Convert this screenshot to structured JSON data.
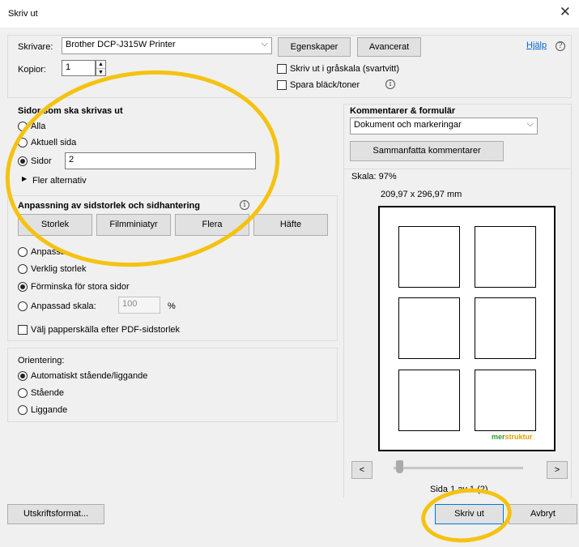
{
  "window": {
    "title": "Skriv ut",
    "close_glyph": "✕"
  },
  "printer": {
    "label": "Skrivare:",
    "value": "Brother DCP-J315W Printer",
    "properties_label": "Egenskaper",
    "advanced_label": "Avancerat",
    "help_label": "Hjälp"
  },
  "copies": {
    "label": "Kopior:",
    "value": "1"
  },
  "options": {
    "grayscale_label": "Skriv ut i gråskala (svartvitt)",
    "grayscale_checked": false,
    "save_ink_label": "Spara bläck/toner",
    "save_ink_checked": false
  },
  "pages_to_print": {
    "heading": "Sidor som ska skrivas ut",
    "all_label": "Alla",
    "current_label": "Aktuell sida",
    "pages_label": "Sidor",
    "pages_value": "2",
    "selected": "pages",
    "more_options_label": "Fler alternativ"
  },
  "sizing": {
    "heading": "Anpassning av sidstorlek och sidhantering",
    "tabs": [
      "Storlek",
      "Filmminiatyr",
      "Flera",
      "Häfte"
    ],
    "fit_label": "Anpassa",
    "actual_label": "Verklig storlek",
    "shrink_label": "Förminska för stora sidor",
    "custom_label": "Anpassad skala:",
    "custom_value": "100",
    "percent": "%",
    "selected": "shrink",
    "paper_source_label": "Välj papperskälla efter PDF-sidstorlek",
    "paper_source_checked": false
  },
  "orientation": {
    "heading": "Orientering:",
    "auto_label": "Automatiskt stående/liggande",
    "portrait_label": "Stående",
    "landscape_label": "Liggande",
    "selected": "auto"
  },
  "comments": {
    "heading": "Kommentarer & formulär",
    "value": "Dokument och markeringar",
    "summarize_label": "Sammanfatta kommentarer"
  },
  "preview": {
    "scale_label": "Skala: 97%",
    "dimensions": "209,97 x 296,97 mm",
    "brand_mer": "mer",
    "brand_struktur": "struktur",
    "brand_colors": {
      "mer": "#2e9d2e",
      "struktur": "#e0a000"
    },
    "prev": "<",
    "next": ">",
    "page_indicator": "Sida 1 av 1 (2)"
  },
  "footer": {
    "page_setup_label": "Utskriftsformat...",
    "print_label": "Skriv ut",
    "cancel_label": "Avbryt"
  },
  "annotations": {
    "highlight_color": "#f5c211"
  }
}
